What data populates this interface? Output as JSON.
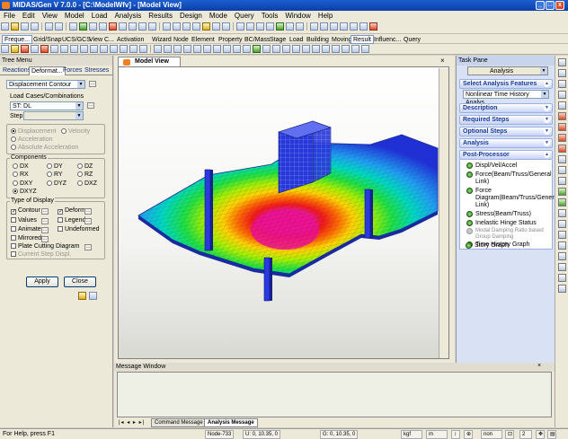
{
  "window": {
    "title": "MIDAS/Gen V 7.0.0 - [C:\\ModelWfv] - [Model View]"
  },
  "menu": [
    "File",
    "Edit",
    "View",
    "Model",
    "Load",
    "Analysis",
    "Results",
    "Design",
    "Mode",
    "Query",
    "Tools",
    "Window",
    "Help"
  ],
  "ribbon_tabs": [
    "Freque...",
    "Grid/Snap",
    "UCS/GCS",
    "View C...",
    "Activation",
    "Wizard",
    "Node",
    "Element",
    "Property",
    "BC/Mass",
    "Stage",
    "Load",
    "Building",
    "Moving",
    "Result",
    "Influenc...",
    "Query"
  ],
  "ribbon_active": "Result",
  "tree_menu": {
    "title": "Tree Menu",
    "tabs": [
      "Reactions",
      "Deformat...",
      "Forces",
      "Stresses"
    ],
    "active_tab": "Deformat...",
    "display_type": "Displacement Contour",
    "load_cases_label": "Load Cases/Combinations",
    "load_case": "ST: DL",
    "step_label": "Step",
    "response_options": [
      "Displacement",
      "Velocity",
      "Acceleration",
      "Absolute Acceleration"
    ],
    "components_label": "Components",
    "components": [
      "DX",
      "DY",
      "DZ",
      "RX",
      "RY",
      "RZ",
      "DXY",
      "DYZ",
      "DXZ",
      "DXYZ"
    ],
    "selected_component": "DXYZ",
    "type_of_display_label": "Type of Display",
    "display_options": [
      {
        "label": "Contour",
        "checked": true
      },
      {
        "label": "Deform",
        "checked": true
      },
      {
        "label": "Values",
        "checked": false
      },
      {
        "label": "Legend",
        "checked": false
      },
      {
        "label": "Animate",
        "checked": false
      },
      {
        "label": "Undeformed",
        "checked": false
      },
      {
        "label": "Mirrored",
        "checked": false
      },
      {
        "label": "Plate Cutting Diagram",
        "checked": false
      },
      {
        "label": "Current Step Displ.",
        "checked": false
      }
    ],
    "apply_label": "Apply",
    "close_label": "Close"
  },
  "model_view": {
    "tab_label": "Model View"
  },
  "task_pane": {
    "title": "Task Pane",
    "dropdown": "Analysis",
    "select_features_label": "Select Analysis Features",
    "feature_value": "Nonlinear Time History Analys",
    "sections": [
      "Description",
      "Required Steps",
      "Optional Steps",
      "Analysis",
      "Post-Processor"
    ],
    "post_items": [
      {
        "label": "Displ/Vel/Accel",
        "enabled": true
      },
      {
        "label": "Force(Beam/Truss/General Link)",
        "enabled": true
      },
      {
        "label": "Force Diagram(Beam/Truss/General Link)",
        "enabled": true
      },
      {
        "label": "Stress(Beam/Truss)",
        "enabled": true
      },
      {
        "label": "Inelastic Hinge Status",
        "enabled": true
      },
      {
        "label": "Modal Damping Ratio based Group Damping",
        "enabled": false
      },
      {
        "label": "Time History Graph",
        "enabled": true
      },
      {
        "label": "Story Graph",
        "enabled": true
      }
    ]
  },
  "message_window": {
    "title": "Message Window",
    "tabs": [
      "Command Message",
      "Analysis Message"
    ],
    "active_tab": "Analysis Message"
  },
  "status_bar": {
    "help": "For Help, press F1",
    "node": "Node-733",
    "u": "U: 0, 10.35, 0",
    "g": "G: 0, 10.35, 0",
    "force_unit": "kgf",
    "length_unit": "m",
    "snap": "non",
    "count": "2"
  },
  "colors": {
    "contour_max": "#e0108a",
    "contour_min": "#1a2ad0",
    "mesh_blue": "#2838d8"
  }
}
